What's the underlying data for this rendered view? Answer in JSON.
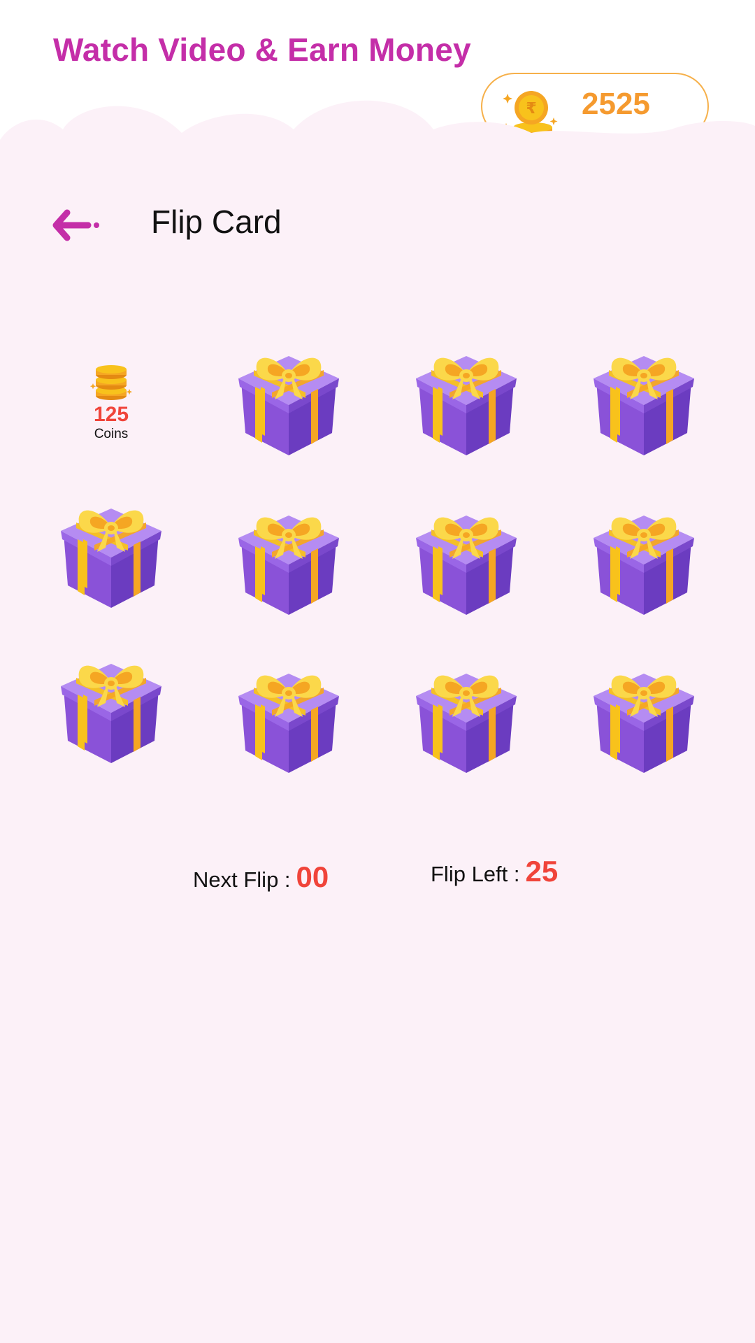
{
  "header": {
    "title": "Watch Video & Earn Money",
    "balance": "2525",
    "balance_icon": "rupee-coin-stack-icon"
  },
  "page": {
    "title": "Flip Card",
    "back_icon": "back-arrow-icon"
  },
  "cards": [
    {
      "state": "revealed",
      "amount": "125",
      "unit": "Coins"
    },
    {
      "state": "hidden"
    },
    {
      "state": "hidden"
    },
    {
      "state": "hidden"
    },
    {
      "state": "hidden"
    },
    {
      "state": "hidden"
    },
    {
      "state": "hidden"
    },
    {
      "state": "hidden"
    },
    {
      "state": "hidden"
    },
    {
      "state": "hidden"
    },
    {
      "state": "hidden"
    },
    {
      "state": "hidden"
    }
  ],
  "stats": {
    "next_flip_label": "Next Flip :",
    "next_flip_value": "00",
    "flip_left_label": "Flip Left :",
    "flip_left_value": "25"
  },
  "colors": {
    "title_magenta": "#c42ea8",
    "coin_orange": "#f59a2f",
    "value_red": "#f0443a",
    "gift_purple": "#8a52d8",
    "ribbon_yellow": "#f8c21c",
    "background_pink": "#fcf1f8"
  }
}
